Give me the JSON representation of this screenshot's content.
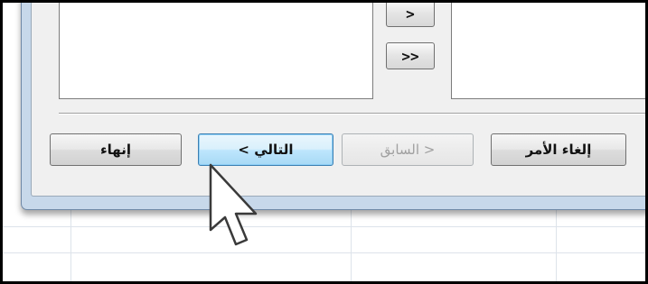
{
  "dialog": {
    "move_buttons": {
      "move_one": ">",
      "move_all": ">>"
    },
    "footer": {
      "finish_label": "إنهاء",
      "next_label": "التالي >",
      "back_label": "< السابق",
      "cancel_label": "إلغاء الأمر"
    },
    "default_button": "next",
    "disabled_buttons": [
      "back"
    ]
  },
  "colors": {
    "dialog_frame": "#c7d8ea",
    "client_background": "#f0f0f0",
    "default_button_highlight": "#bee6fd",
    "disabled_text": "#a0a0a0"
  },
  "pointer": {
    "icon": "mouse-pointer-icon"
  }
}
